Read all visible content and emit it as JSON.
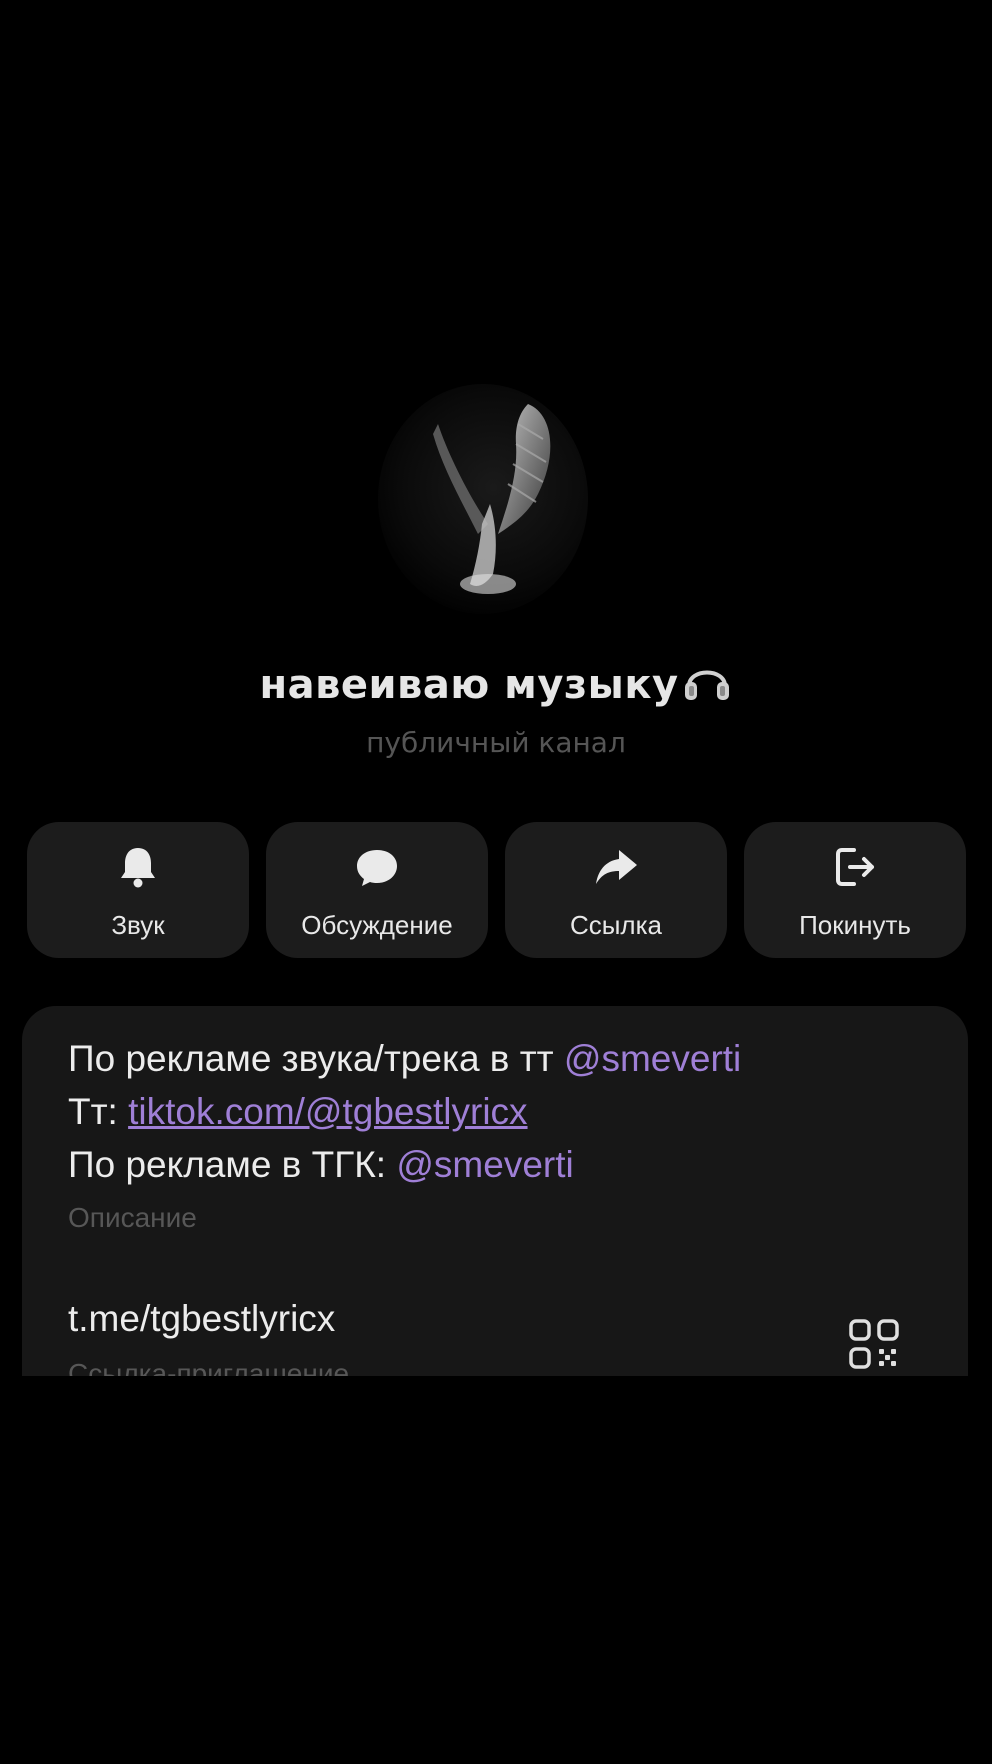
{
  "channel": {
    "name": "навеиваю музыку",
    "type_label": "публичный канал"
  },
  "actions": [
    {
      "label": "Звук",
      "icon": "bell-icon"
    },
    {
      "label": "Обсуждение",
      "icon": "chat-bubble-icon"
    },
    {
      "label": "Ссылка",
      "icon": "share-arrow-icon"
    },
    {
      "label": "Покинуть",
      "icon": "leave-icon"
    }
  ],
  "info": {
    "description": {
      "line1_text": "По рекламе звука/трека в тт ",
      "line1_mention": "@smeverti",
      "line2_text": "Тт: ",
      "line2_link": "tiktok.com/@tgbestlyricx",
      "line3_text": "По рекламе в ТГК: ",
      "line3_mention": "@smeverti"
    },
    "description_caption": "Описание",
    "invite_link": "t.me/tgbestlyricx",
    "invite_caption": "Ссылка-приглашение"
  },
  "colors": {
    "background": "#000000",
    "card": "#1c1c1c",
    "accent": "#9f7fd6",
    "muted": "#575757"
  }
}
